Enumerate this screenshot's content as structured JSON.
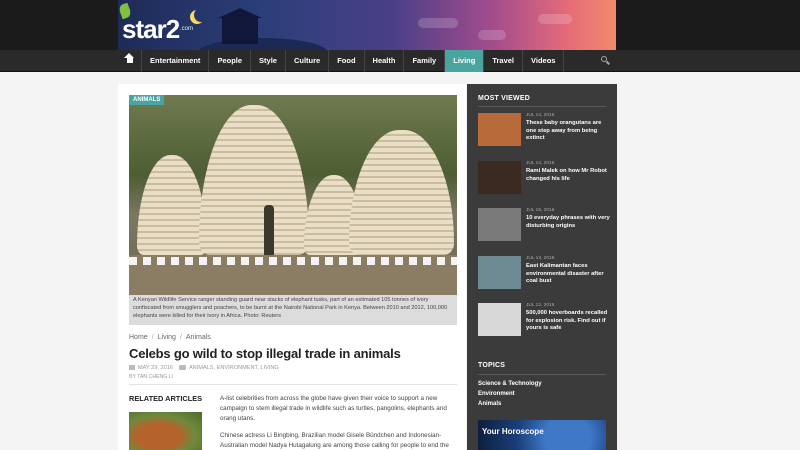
{
  "header": {
    "logo_text": "star2",
    "logo_sub": ".com"
  },
  "nav": {
    "items": [
      {
        "label": "Entertainment"
      },
      {
        "label": "People"
      },
      {
        "label": "Style"
      },
      {
        "label": "Culture"
      },
      {
        "label": "Food"
      },
      {
        "label": "Health"
      },
      {
        "label": "Family"
      },
      {
        "label": "Living",
        "active": true
      },
      {
        "label": "Travel"
      },
      {
        "label": "Videos"
      }
    ]
  },
  "article": {
    "category_tag": "ANIMALS",
    "caption": "A Kenyan Wildlife Service ranger standing guard near stacks of elephant tusks, part of an estimated 105 tonnes of ivory confiscated from smugglers and poachers, to be burnt at the Nairobi National Park in Kenya. Between 2010 and 2012, 100,000 elephants were killed for their ivory in Africa. Photo: Reuters",
    "breadcrumb": [
      "Home",
      "Living",
      "Animals"
    ],
    "title": "Celebs go wild to stop illegal trade in animals",
    "date": "MAY 29, 2016",
    "categories": "ANIMALS, ENVIRONMENT, LIVING",
    "byline": "BY TAN CHENG LI",
    "related_heading": "RELATED ARTICLES",
    "paragraphs": [
      "A-list celebrities from across the globe have given their voice to support a new campaign to stem illegal trade in wildlife such as turtles, pangolins, elephants and orang utans.",
      "Chinese actress Li Bingbing, Brazilian model Gisele Bündchen and Indonesian-Australian model Nadya Hutagalung are among those calling for people to end the demand for wildlife parts, which is pushing various species towards extinction."
    ]
  },
  "sidebar": {
    "most_viewed_heading": "MOST VIEWED",
    "most_viewed": [
      {
        "date": "JUL 14, 2016",
        "title": "These baby orangutans are one step away from being extinct",
        "thumb_color": "#b86a3a"
      },
      {
        "date": "JUL 14, 2016",
        "title": "Rami Malek on how Mr Robot changed his life",
        "thumb_color": "#3a2a22"
      },
      {
        "date": "JUL 15, 2016",
        "title": "10 everyday phrases with very disturbing origins",
        "thumb_color": "#7a7a7a"
      },
      {
        "date": "JUL 13, 2016",
        "title": "East Kalimantan faces environmental disaster after coal bust",
        "thumb_color": "#6e8a92"
      },
      {
        "date": "JUL 12, 2016",
        "title": "500,000 hoverboards recalled for explosion risk. Find out if yours is safe",
        "thumb_color": "#d8d8d8"
      }
    ],
    "topics_heading": "TOPICS",
    "topics": [
      "Science & Technology",
      "Environment",
      "Animals"
    ],
    "ad_text": "Your Horoscope"
  }
}
